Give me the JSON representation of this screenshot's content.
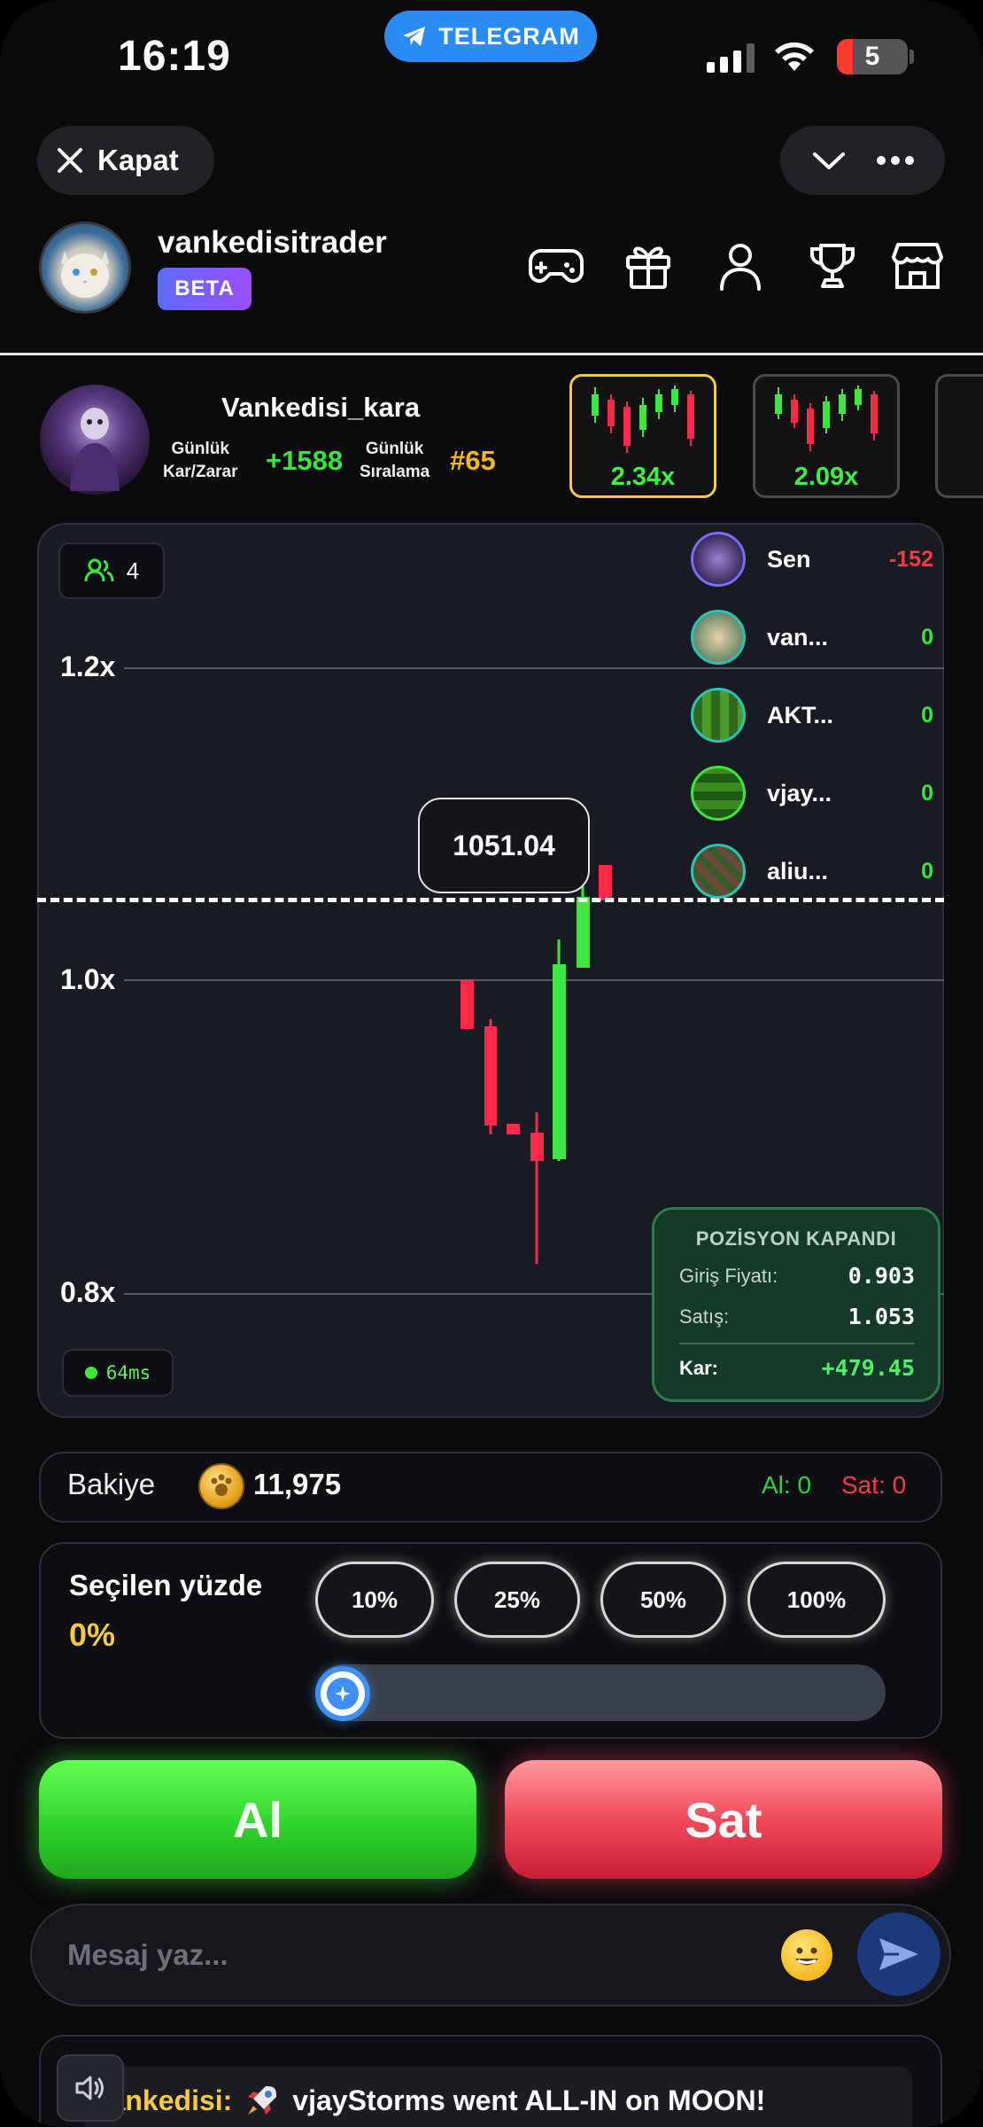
{
  "status_bar": {
    "time": "16:19",
    "telegram_label": "TELEGRAM",
    "battery": "5"
  },
  "top_bar": {
    "close_label": "Kapat"
  },
  "profile": {
    "username": "vankedisitrader",
    "badge": "BETA"
  },
  "trader": {
    "name": "Vankedisi_kara",
    "pnl_label_1": "Günlük",
    "pnl_label_2": "Kar/Zarar",
    "pnl_value": "+1588",
    "rank_label_1": "Günlük",
    "rank_label_2": "Sıralama",
    "rank_value": "#65"
  },
  "round_cards": [
    {
      "multiplier": "2.34x",
      "selected": true
    },
    {
      "multiplier": "2.09x",
      "selected": false
    }
  ],
  "chart": {
    "online_count": "4",
    "axis_labels": [
      "1.2x",
      "1.0x",
      "0.8x"
    ],
    "current_price": "1051.04",
    "latency": "64ms"
  },
  "chart_data": {
    "type": "candlestick",
    "y_ticks": [
      "1.2x",
      "1.0x",
      "0.8x"
    ],
    "current_price": "1051.04"
  },
  "players": [
    {
      "name": "Sen",
      "value": "-152",
      "negative": true
    },
    {
      "name": "van...",
      "value": "0",
      "negative": false
    },
    {
      "name": "AKT...",
      "value": "0",
      "negative": false
    },
    {
      "name": "vjay...",
      "value": "0",
      "negative": false
    },
    {
      "name": "aliu...",
      "value": "0",
      "negative": false
    }
  ],
  "position_closed": {
    "title": "POZİSYON KAPANDI",
    "entry_label": "Giriş Fiyatı:",
    "entry_value": "0.903",
    "exit_label": "Satış:",
    "exit_value": "1.053",
    "profit_label": "Kar:",
    "profit_value": "+479.45"
  },
  "balance": {
    "label": "Bakiye",
    "value": "11,975",
    "buy_count": "Al: 0",
    "sell_count": "Sat: 0"
  },
  "percent": {
    "title": "Seçilen yüzde",
    "value": "0%",
    "options": [
      "10%",
      "25%",
      "50%",
      "100%"
    ],
    "slider_level": 0
  },
  "actions": {
    "buy_label": "Al",
    "sell_label": "Sat"
  },
  "message": {
    "placeholder": "Mesaj yaz..."
  },
  "ticker": {
    "author": "Vankedisi:",
    "text": "vjayStorms went ALL-IN on MOON!"
  },
  "colors": {
    "green": "#38e63b",
    "red": "#ff3b4a",
    "gold": "#f7c944",
    "accent_blue": "#2a8bf2"
  }
}
